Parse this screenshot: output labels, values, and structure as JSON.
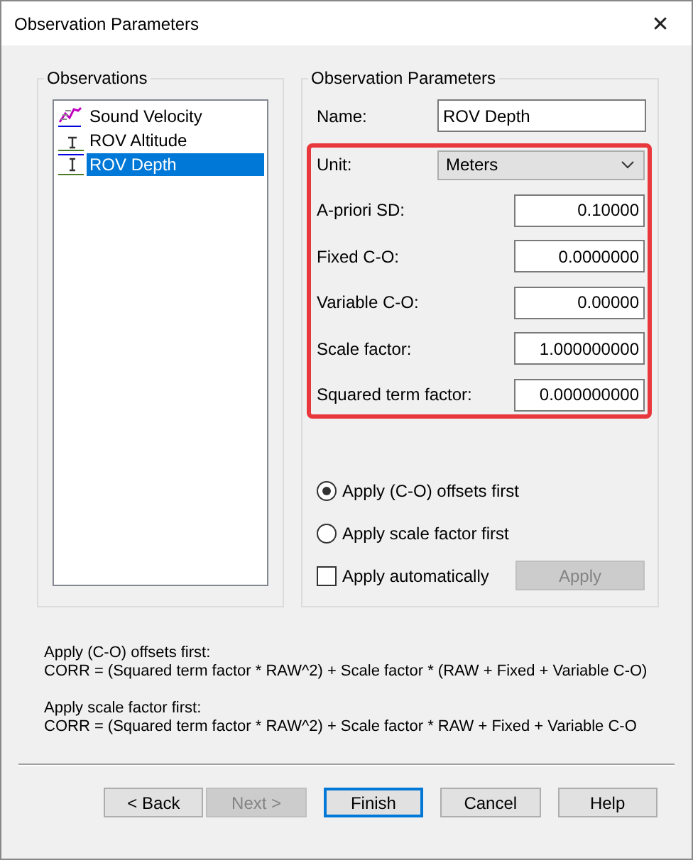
{
  "window": {
    "title": "Observation Parameters",
    "close": "✕"
  },
  "observations": {
    "title": "Observations",
    "items": [
      {
        "label": "Sound Velocity",
        "kind": "velocity",
        "selected": false
      },
      {
        "label": "ROV Altitude",
        "kind": "altitude",
        "selected": false
      },
      {
        "label": "ROV Depth",
        "kind": "depth",
        "selected": true
      }
    ]
  },
  "parameters": {
    "title": "Observation Parameters",
    "name": {
      "label": "Name:",
      "value": "ROV Depth"
    },
    "unit": {
      "label": "Unit:",
      "value": "Meters"
    },
    "fields": [
      {
        "label": "A-priori SD:",
        "value": "0.10000"
      },
      {
        "label": "Fixed C-O:",
        "value": "0.0000000"
      },
      {
        "label": "Variable C-O:",
        "value": "0.00000"
      },
      {
        "label": "Scale factor:",
        "value": "1.000000000"
      },
      {
        "label": "Squared term factor:",
        "value": "0.000000000"
      }
    ],
    "order_options": [
      {
        "label": "Apply (C-O) offsets first",
        "selected": true
      },
      {
        "label": "Apply scale factor first",
        "selected": false
      }
    ],
    "apply_automatically": {
      "label": "Apply automatically",
      "checked": false
    },
    "apply_button": {
      "label": "Apply",
      "disabled": true
    }
  },
  "notes": [
    {
      "heading": "Apply (C-O) offsets first:",
      "formula": "CORR = (Squared term factor * RAW^2) + Scale factor * (RAW + Fixed + Variable C-O)"
    },
    {
      "heading": "Apply scale factor first:",
      "formula": "CORR = (Squared term factor * RAW^2) + Scale factor * RAW + Fixed + Variable C-O"
    }
  ],
  "buttons": [
    {
      "label": "< Back",
      "disabled": false,
      "default": false
    },
    {
      "label": "Next >",
      "disabled": true,
      "default": false
    },
    {
      "label": "Finish",
      "disabled": false,
      "default": true
    },
    {
      "label": "Cancel",
      "disabled": false,
      "default": false
    },
    {
      "label": "Help",
      "disabled": false,
      "default": false
    }
  ]
}
